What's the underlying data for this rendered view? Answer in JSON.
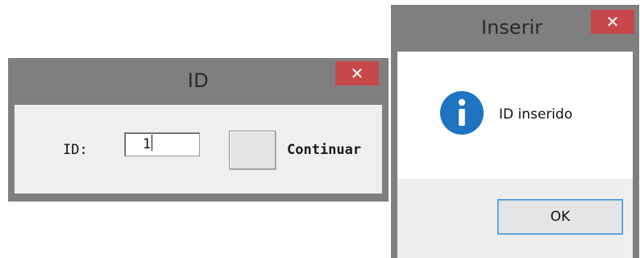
{
  "id_window": {
    "title": "ID",
    "close_glyph": "✕",
    "id_label": "ID:",
    "id_value": "1",
    "continue_label": "Continuar"
  },
  "message_box": {
    "title": "Inserir",
    "close_glyph": "✕",
    "message": "ID inserido",
    "icon": "info-icon",
    "ok_label": "OK"
  },
  "colors": {
    "close_red": "#c7484b",
    "info_blue": "#1f74c1",
    "frame_gray": "#7f7f7f"
  }
}
